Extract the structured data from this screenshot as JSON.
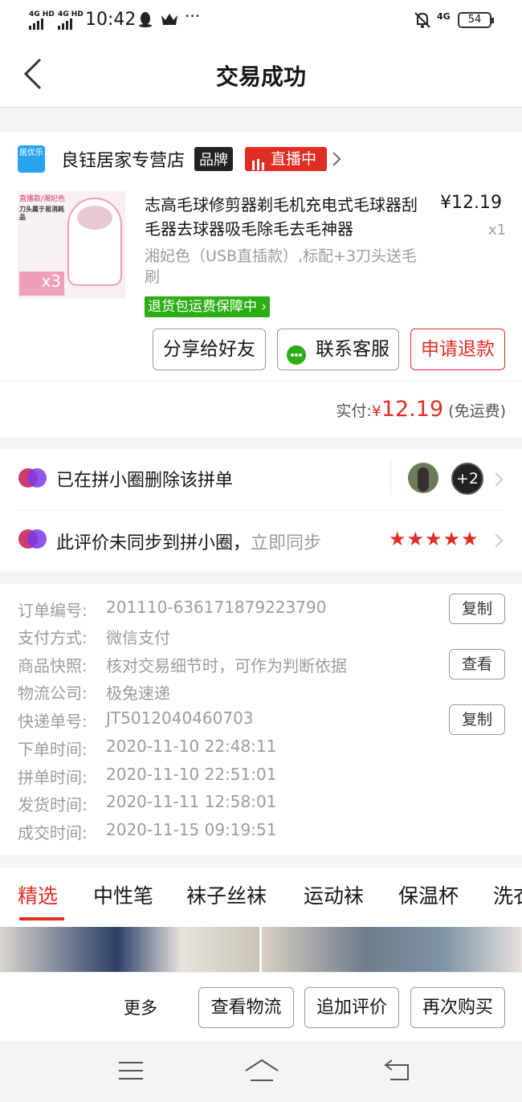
{
  "status_bar": {
    "net1": "4G HD",
    "net2": "4G HD",
    "time": "10:42",
    "more": "···",
    "net3": "4G",
    "battery": "54"
  },
  "nav": {
    "title": "交易成功"
  },
  "store": {
    "logo_text": "居优乐",
    "name": "良钰居家专营店",
    "brand_badge": "品牌",
    "live_badge": "直播中"
  },
  "product": {
    "thumb_text_1": "直播款/湘妃色",
    "thumb_text_2": "刀头属于易消耗品",
    "thumb_text_3": "x3",
    "title": "志高毛球修剪器剃毛机充电式毛球器刮毛器去球器吸毛除毛去毛神器",
    "price": "¥12.19",
    "qty": "x1",
    "spec": "湘妃色（USB直插款）,标配+3刀头送毛刷",
    "guarantee": "退货包运费保障中"
  },
  "actions": {
    "share": "分享给好友",
    "service": "联系客服",
    "refund": "申请退款"
  },
  "payment": {
    "label": "实付:",
    "currency": "¥",
    "amount": "12.19",
    "note": "(免运费)"
  },
  "circle": {
    "deleted_text": "已在拼小圈删除该拼单",
    "avatar_more": "+2",
    "review_text": "此评价未同步到拼小圈，",
    "sync_link": "立即同步",
    "stars": "★★★★★",
    "rating": 5
  },
  "order": {
    "rows": [
      {
        "label": "订单编号:",
        "value": "201110-636171879223790",
        "button": "复制"
      },
      {
        "label": "支付方式:",
        "value": "微信支付"
      },
      {
        "label": "商品快照:",
        "value": "核对交易细节时，可作为判断依据",
        "button": "查看"
      },
      {
        "label": "物流公司:",
        "value": "极兔速递"
      },
      {
        "label": "快递单号:",
        "value": "JT5012040460703",
        "button": "复制"
      },
      {
        "label": "下单时间:",
        "value": "2020-11-10 22:48:11"
      },
      {
        "label": "拼单时间:",
        "value": "2020-11-10 22:51:01"
      },
      {
        "label": "发货时间:",
        "value": "2020-11-11 12:58:01"
      },
      {
        "label": "成交时间:",
        "value": "2020-11-15 09:19:51"
      }
    ]
  },
  "tabs": [
    "精选",
    "中性笔",
    "袜子丝袜",
    "运动袜",
    "保温杯",
    "洗衣"
  ],
  "bottom_bar": {
    "more": "更多",
    "logistics": "查看物流",
    "add_review": "追加评价",
    "rebuy": "再次购买"
  },
  "colors": {
    "accent": "#e02e24",
    "green": "#2bad13"
  }
}
